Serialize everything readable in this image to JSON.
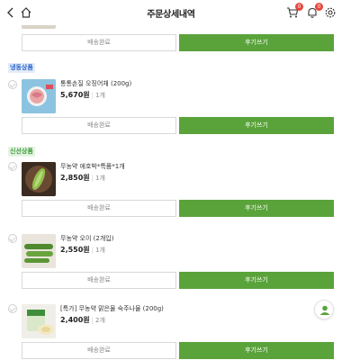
{
  "header": {
    "title": "주문상세내역",
    "back_icon": "chevron-left-icon",
    "home_icon": "home-icon",
    "cart_badge": "0",
    "notification_badge": "0"
  },
  "top_item": {
    "done_label": "배송완료",
    "review_label": "후기쓰기"
  },
  "sections": [
    {
      "tag": "냉동상품",
      "items": [
        {
          "name": "통통손질 오징어채 (200g)",
          "price": "5,670원",
          "qty": "1개",
          "done_label": "배송완료",
          "review_label": "후기쓰기"
        }
      ]
    },
    {
      "tag": "신선상품",
      "items": [
        {
          "name": "무농약 애호박*특품*1개",
          "price": "2,850원",
          "qty": "1개",
          "done_label": "배송완료",
          "review_label": "후기쓰기"
        },
        {
          "name": "무농약 오이 (2개입)",
          "price": "2,550원",
          "qty": "1개",
          "done_label": "배송완료",
          "review_label": "후기쓰기"
        },
        {
          "name": "[특가] 무농약 맑은물 숙주나물 (200g)",
          "price": "2,400원",
          "qty": "2개",
          "done_label": "배송완료",
          "review_label": "후기쓰기"
        }
      ]
    }
  ],
  "colors": {
    "accent_green": "#5aa33b",
    "frozen_tag": "#2a64c9",
    "fresh_tag": "#3b9a3b",
    "badge_red": "#e8453c"
  }
}
